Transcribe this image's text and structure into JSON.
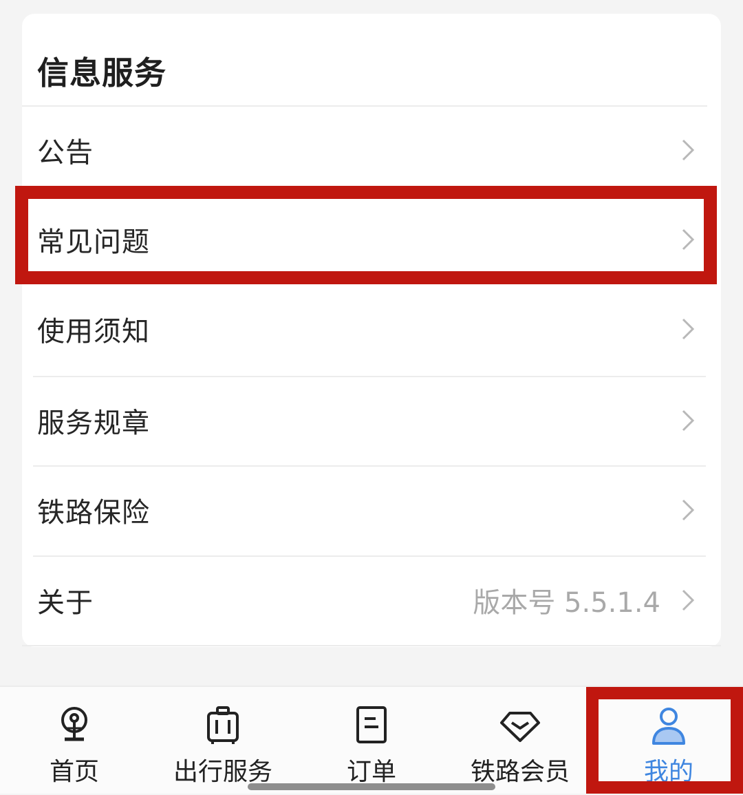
{
  "section": {
    "title": "信息服务",
    "items": [
      {
        "label": "公告",
        "value": ""
      },
      {
        "label": "常见问题",
        "value": ""
      },
      {
        "label": "使用须知",
        "value": ""
      },
      {
        "label": "服务规章",
        "value": ""
      },
      {
        "label": "铁路保险",
        "value": ""
      },
      {
        "label": "关于",
        "value": "版本号 5.5.1.4"
      }
    ]
  },
  "highlighted_item": "常见问题",
  "tabbar": {
    "tabs": [
      {
        "label": "首页",
        "icon": "railway-logo-icon"
      },
      {
        "label": "出行服务",
        "icon": "luggage-icon"
      },
      {
        "label": "订单",
        "icon": "document-icon"
      },
      {
        "label": "铁路会员",
        "icon": "diamond-icon"
      },
      {
        "label": "我的",
        "icon": "person-icon"
      }
    ],
    "active": "我的"
  },
  "colors": {
    "accent": "#3f86e0",
    "highlight": "#c0170f",
    "secondary_text": "#a9a9a9"
  }
}
